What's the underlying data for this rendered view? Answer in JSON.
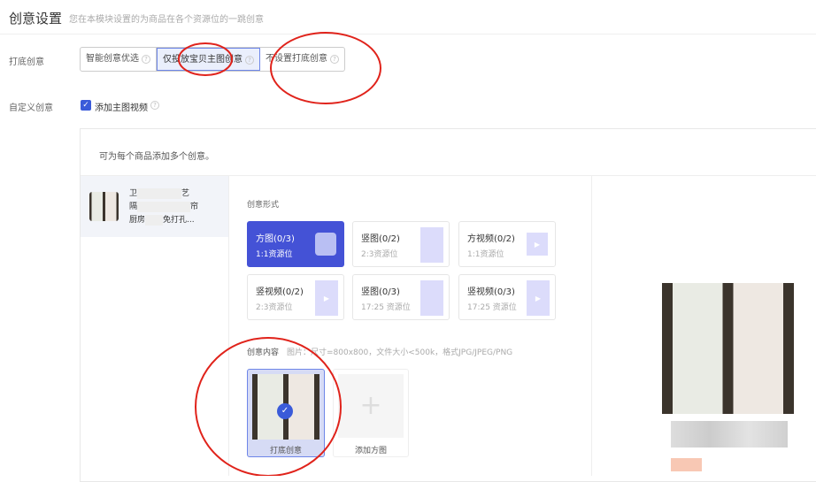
{
  "header": {
    "title": "创意设置",
    "subtitle": "您在本模块设置的为商品在各个资源位的一跳创意"
  },
  "fallback": {
    "label": "打底创意",
    "options": [
      "智能创意优选",
      "仅投放宝贝主图创意",
      "不设置打底创意"
    ],
    "selected": 1
  },
  "custom": {
    "label": "自定义创意",
    "checkbox_label": "添加主图视频",
    "checked": true
  },
  "panel": {
    "hint": "可为每个商品添加多个创意。",
    "product": {
      "title_lines": [
        "卫",
        "艺",
        "隔",
        "帘",
        "厨房",
        "免打孔..."
      ]
    },
    "form_label": "创意形式",
    "forms": [
      {
        "name": "方图(0/3)",
        "ratio": "1:1资源位",
        "active": true,
        "icon": "square-image-icon"
      },
      {
        "name": "竖图(0/2)",
        "ratio": "2:3资源位",
        "icon": "vertical-image-icon"
      },
      {
        "name": "方视频(0/2)",
        "ratio": "1:1资源位",
        "icon": "video-icon"
      },
      {
        "name": "竖视频(0/2)",
        "ratio": "2:3资源位",
        "icon": "video-icon"
      },
      {
        "name": "竖图(0/3)",
        "ratio": "17:25 资源位",
        "icon": "vertical-image-icon"
      },
      {
        "name": "竖视频(0/3)",
        "ratio": "17:25 资源位",
        "icon": "video-icon"
      }
    ],
    "content_label": "创意内容",
    "content_hint": "图片：尺寸=800x800，文件大小<500k，格式JPG/JPEG/PNG",
    "thumb_label": "打底创意",
    "add_label": "添加方图"
  },
  "colors": {
    "accent": "#4452d6",
    "annotation": "#e0231b"
  }
}
